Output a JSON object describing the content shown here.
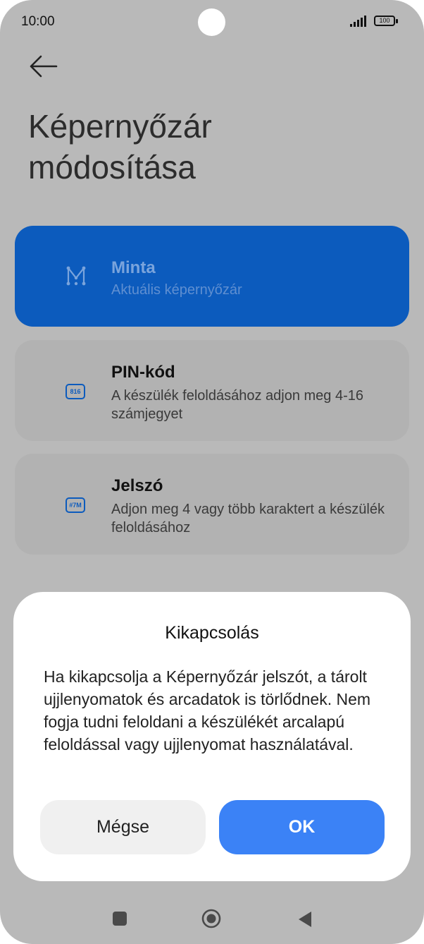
{
  "status_bar": {
    "time": "10:00",
    "battery": "100"
  },
  "header": {
    "title": "Képernyőzár módosítása"
  },
  "options": [
    {
      "title": "Minta",
      "subtitle": "Aktuális képernyőzár",
      "icon": "pattern-icon"
    },
    {
      "title": "PIN-kód",
      "subtitle": "A készülék feloldásához adjon meg 4-16 számjegyet",
      "icon": "pin-icon",
      "icon_text": "816"
    },
    {
      "title": "Jelszó",
      "subtitle": "Adjon meg 4 vagy több karaktert a készülék feloldásához",
      "icon": "password-icon",
      "icon_text": "#7M"
    }
  ],
  "dialog": {
    "title": "Kikapcsolás",
    "body": "Ha kikapcsolja a Képernyőzár jelszót, a tárolt ujjlenyomatok és arcadatok is törlődnek. Nem fogja tudni feloldani a készülékét arcalapú feloldással vagy ujjlenyomat használatával.",
    "cancel_label": "Mégse",
    "ok_label": "OK"
  },
  "colors": {
    "accent": "#0c5bbd",
    "ok_button": "#3b82f6"
  }
}
